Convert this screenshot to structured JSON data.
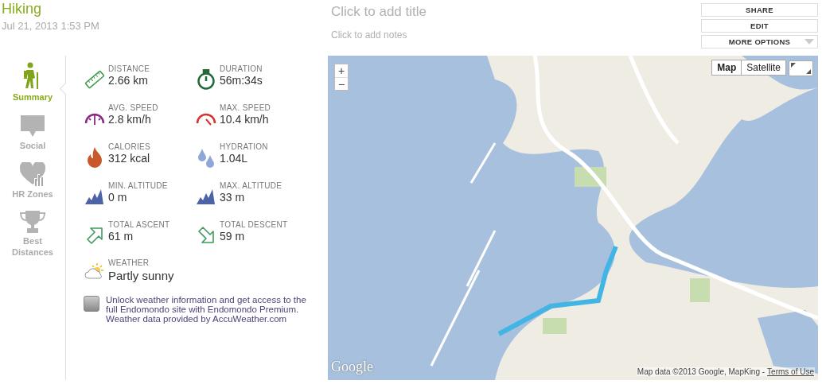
{
  "activity": {
    "title": "Hiking",
    "date": "Jul 21, 2013 1:53 PM"
  },
  "notes": {
    "title": {
      "placeholder": "Click to add title"
    },
    "notes": {
      "placeholder": "Click to add notes"
    }
  },
  "actions": [
    {
      "label": "SHARE",
      "kind": "plain"
    },
    {
      "label": "EDIT",
      "kind": "plain"
    },
    {
      "label": "MORE OPTIONS",
      "kind": "dropdown"
    }
  ],
  "nav": [
    {
      "label": "Summary",
      "kind": "hiker",
      "selected": true
    },
    {
      "label": "Social",
      "kind": "chat",
      "selected": false
    },
    {
      "label": "HR Zones",
      "kind": "heart",
      "selected": false
    },
    {
      "label": "Best Distances",
      "kind": "trophy",
      "selected": false
    }
  ],
  "stats": [
    {
      "label": "DISTANCE",
      "value": "2.66 km",
      "kind": "ruler"
    },
    {
      "label": "DURATION",
      "value": "56m:34s",
      "kind": "stopwatch"
    },
    {
      "label": "AVG. SPEED",
      "value": "2.8 km/h",
      "kind": "gauge-avg"
    },
    {
      "label": "MAX. SPEED",
      "value": "10.4 km/h",
      "kind": "gauge-max"
    },
    {
      "label": "CALORIES",
      "value": "312 kcal",
      "kind": "flame"
    },
    {
      "label": "HYDRATION",
      "value": "1.04L",
      "kind": "drops"
    },
    {
      "label": "MIN. ALTITUDE",
      "value": "0 m",
      "kind": "mountains"
    },
    {
      "label": "MAX. ALTITUDE",
      "value": "33 m",
      "kind": "mountains"
    },
    {
      "label": "TOTAL ASCENT",
      "value": "61 m",
      "kind": "ascent"
    },
    {
      "label": "TOTAL DESCENT",
      "value": "59 m",
      "kind": "descent"
    }
  ],
  "weather": {
    "label": "WEATHER",
    "value": "Partly sunny"
  },
  "promo": {
    "lines": [
      "Unlock weather information and get access to the full Endomondo site with Endomondo Premium.",
      "Weather data provided by AccuWeather.com"
    ]
  },
  "map": {
    "kind": "picture",
    "zoom": [
      "+",
      "−"
    ],
    "map_types": [
      {
        "label": "Map",
        "selected": true
      },
      {
        "label": "Satellite",
        "selected": false
      }
    ],
    "logo": "Google",
    "attribution": "Map data ©2013 Google, MapKing -",
    "terms_link": "Terms of Use"
  }
}
